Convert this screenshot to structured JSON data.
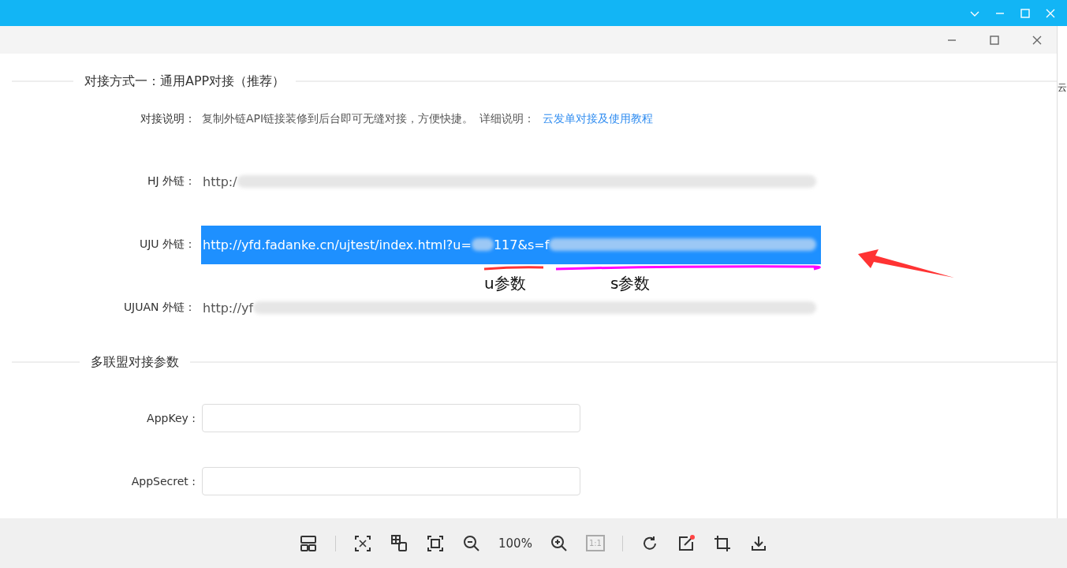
{
  "section_one": {
    "title": "对接方式一：通用APP对接（推荐）",
    "description": {
      "label": "对接说明：",
      "text": "复制外链API链接装修到后台即可无缝对接，方便快捷。",
      "detail_label": "详细说明：",
      "link": "云发单对接及使用教程"
    },
    "links": [
      {
        "label": "HJ 外链：",
        "selected": false,
        "segments": [
          {
            "kind": "text",
            "text": "http:/"
          },
          {
            "kind": "smudge"
          }
        ]
      },
      {
        "label": "UJU 外链：",
        "selected": true,
        "segments": [
          {
            "kind": "text",
            "text": "http://yfd.fadanke.cn/ujtest/index.html?u="
          },
          {
            "kind": "smudge"
          },
          {
            "kind": "text",
            "text": "117&s=f"
          },
          {
            "kind": "smudge"
          }
        ]
      },
      {
        "label": "UJUAN 外链：",
        "selected": false,
        "segments": [
          {
            "kind": "text",
            "text": "http://yf"
          },
          {
            "kind": "smudge"
          }
        ]
      }
    ]
  },
  "annotations": {
    "u_label": "u参数",
    "s_label": "s参数"
  },
  "edge_text": "云",
  "section_two": {
    "title": "多联盟对接参数",
    "fields": [
      {
        "label": "AppKey :"
      },
      {
        "label": "AppSecret :"
      }
    ]
  },
  "toolbar": {
    "zoom": "100%",
    "actual_size": {
      "label": "1:1",
      "disabled": true
    }
  }
}
